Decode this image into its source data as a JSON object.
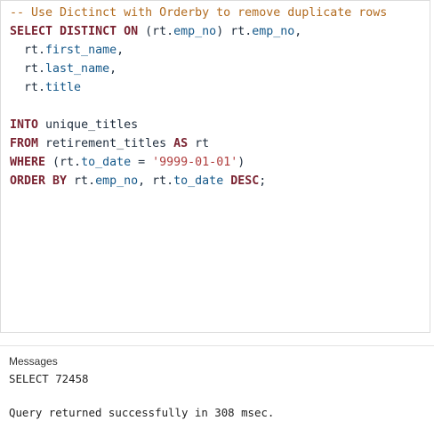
{
  "editor": {
    "line1": {
      "comment": "-- Use Dictinct with Orderby to remove duplicate rows"
    },
    "line2": {
      "kw": "SELECT DISTINCT ON",
      "p1": " (rt.",
      "c1": "emp_no",
      "p2": ") rt.",
      "c2": "emp_no",
      "p3": ","
    },
    "line3": {
      "p1": "  rt.",
      "c1": "first_name",
      "p2": ","
    },
    "line4": {
      "p1": "  rt.",
      "c1": "last_name",
      "p2": ","
    },
    "line5": {
      "p1": "  rt.",
      "c1": "title"
    },
    "line7": {
      "kw": "INTO",
      "p1": " unique_titles"
    },
    "line8": {
      "kw1": "FROM",
      "p1": " retirement_titles ",
      "kw2": "AS",
      "p2": " rt"
    },
    "line9": {
      "kw": "WHERE",
      "p1": " (rt.",
      "c1": "to_date",
      "p2": " = ",
      "s1": "'9999-01-01'",
      "p3": ")"
    },
    "line10": {
      "kw": "ORDER BY",
      "p1": " rt.",
      "c1": "emp_no",
      "p2": ", rt.",
      "c2": "to_date",
      "p3": " ",
      "kw2": "DESC",
      "p4": ";"
    }
  },
  "messages": {
    "title": "Messages",
    "line1": "SELECT 72458",
    "line2": "Query returned successfully in 308 msec."
  },
  "colors": {
    "keyword": "#7a2331",
    "column": "#16598a",
    "comment": "#b26b1f",
    "string": "#b03c3c"
  }
}
